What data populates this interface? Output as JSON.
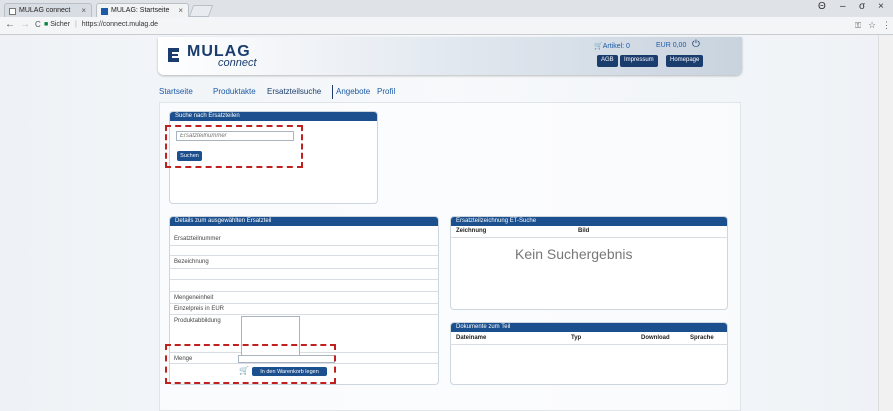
{
  "browser": {
    "tabs": [
      {
        "label": "MULAG connect",
        "close": "×"
      },
      {
        "label": "MULAG: Startseite",
        "close": "×"
      }
    ],
    "address": {
      "secure_label": "Sicher",
      "url": "https://connect.mulag.de"
    },
    "nav": {
      "back": "←",
      "forward": "→",
      "reload": "C"
    },
    "window": {
      "account": "Θ",
      "minimize": "–",
      "maximize": "σ",
      "close": "×",
      "key": "⚿",
      "star": "☆",
      "menu": "⋮"
    }
  },
  "header": {
    "brand": "MULAG",
    "subtitle": "connect",
    "cart_label": "Artikel: 0",
    "price": "EUR 0,00",
    "buttons": [
      "AGB",
      "Impressum",
      "Homepage"
    ]
  },
  "nav": {
    "items": [
      "Startseite",
      "Produktakte",
      "Ersatzteilsuche",
      "Angebote",
      "Profil"
    ],
    "active": "Ersatzteilsuche"
  },
  "search_panel": {
    "title": "Suche nach Ersatzteilen",
    "placeholder": "Ersatzteilnummer",
    "button": "Suchen"
  },
  "details_panel": {
    "title": "Details zum ausgewählten Ersatzteil",
    "fields": [
      "Ersatzteilnummer",
      "Bezeichnung",
      "Mengeneinheit",
      "Einzelpreis in EUR",
      "Produktabbildung"
    ],
    "quantity_label": "Menge",
    "add_to_cart": "In den Warenkorb legen"
  },
  "drawing_panel": {
    "title": "Ersatzteilzeichnung ET-Suche",
    "columns": [
      "Zeichnung",
      "Bild"
    ],
    "no_result": "Kein Suchergebnis"
  },
  "documents_panel": {
    "title": "Dokumente zum Teil",
    "columns": [
      "Dateiname",
      "Typ",
      "Download",
      "Sprache"
    ]
  },
  "colors": {
    "primary": "#1b4f8e",
    "brand": "#1b3d6e",
    "highlight": "#c0211f"
  }
}
